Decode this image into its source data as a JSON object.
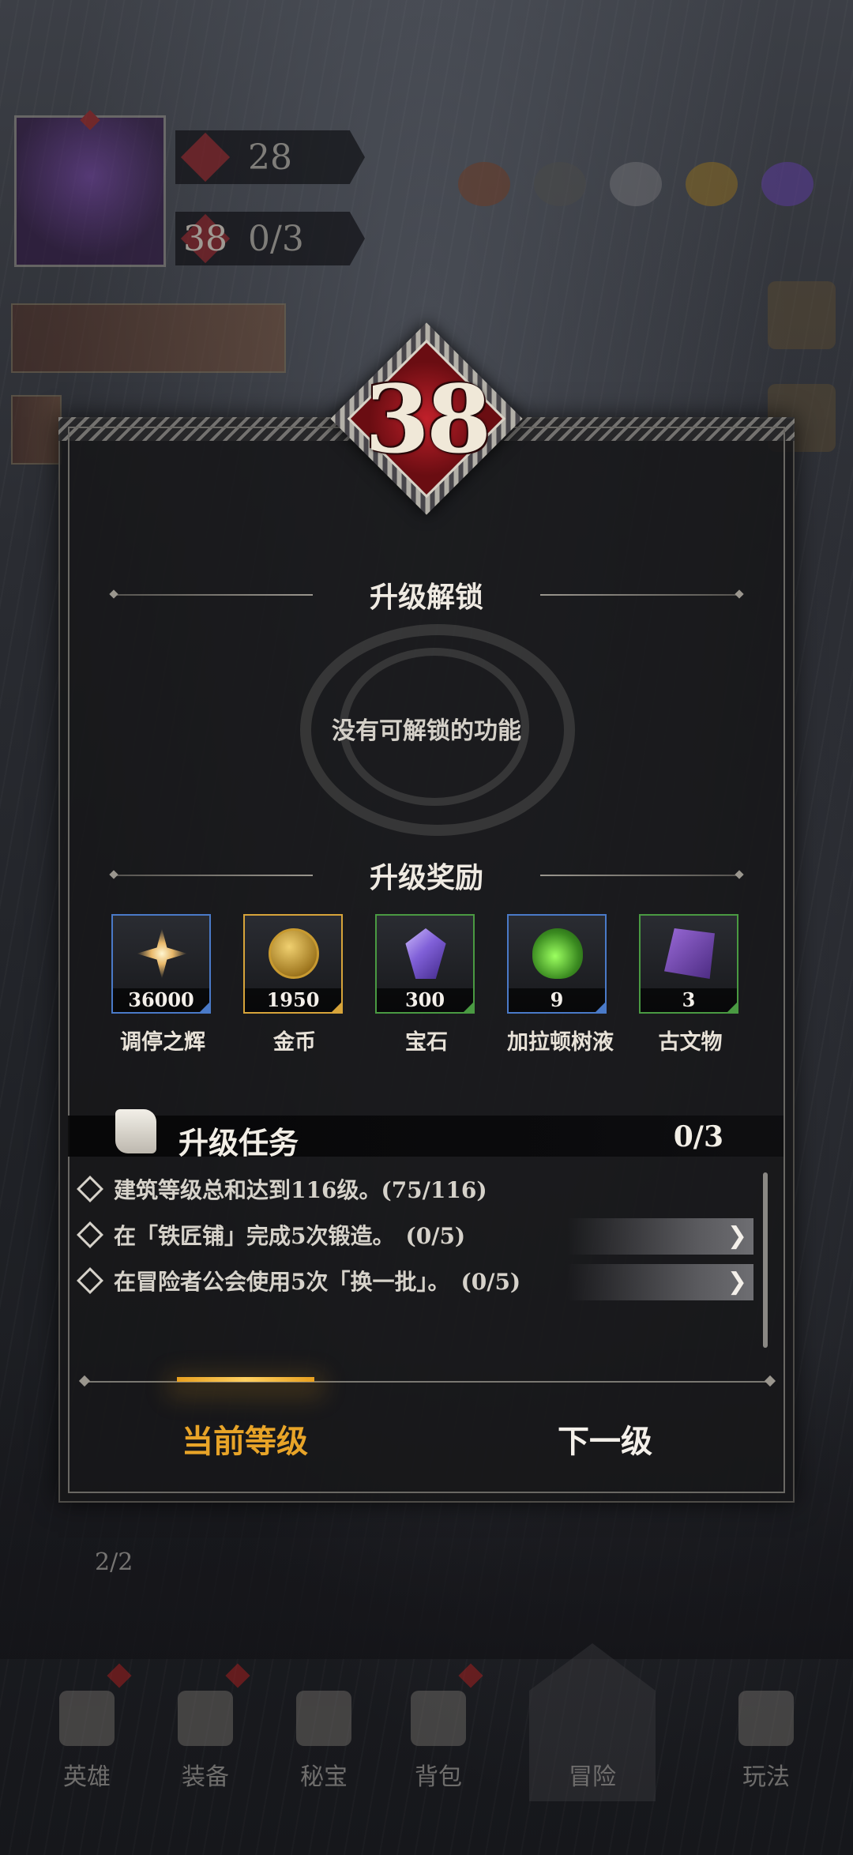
{
  "hud": {
    "bar1_value": "28",
    "bar2_level": "38",
    "bar2_progress": "0/3",
    "stage_progress": "2/2"
  },
  "level_badge": "38",
  "unlock_section": {
    "title": "升级解锁",
    "empty_text": "没有可解锁的功能"
  },
  "reward_section": {
    "title": "升级奖励",
    "items": [
      {
        "label": "调停之辉",
        "count": "36000",
        "icon": "radiance-icon",
        "rarity_color": "#4a7ac8"
      },
      {
        "label": "金币",
        "count": "1950",
        "icon": "gold-coin-icon",
        "rarity_color": "#d7a43a"
      },
      {
        "label": "宝石",
        "count": "300",
        "icon": "gem-icon",
        "rarity_color": "#4a9a42"
      },
      {
        "label": "加拉顿树液",
        "count": "9",
        "icon": "potion-icon",
        "rarity_color": "#4a7ac8"
      },
      {
        "label": "古文物",
        "count": "3",
        "icon": "relic-icon",
        "rarity_color": "#4a9a42"
      }
    ]
  },
  "task_section": {
    "title": "升级任务",
    "progress": "0/3",
    "tasks": [
      {
        "text": "建筑等级总和达到116级。(75/116)",
        "has_go": false
      },
      {
        "text": "在「铁匠铺」完成5次锻造。　(0/5)",
        "has_go": true
      },
      {
        "text": "在冒险者公会使用5次「换一批」。　(0/5)",
        "has_go": true
      }
    ]
  },
  "tabs": {
    "current": "当前等级",
    "next": "下一级"
  },
  "bottom_nav": {
    "items": [
      "英雄",
      "装备",
      "秘宝",
      "背包",
      "冒险",
      "玩法"
    ]
  },
  "colors": {
    "accent_gold": "#e8a428",
    "panel_bg": "#171719",
    "badge_red": "#c0202a"
  }
}
